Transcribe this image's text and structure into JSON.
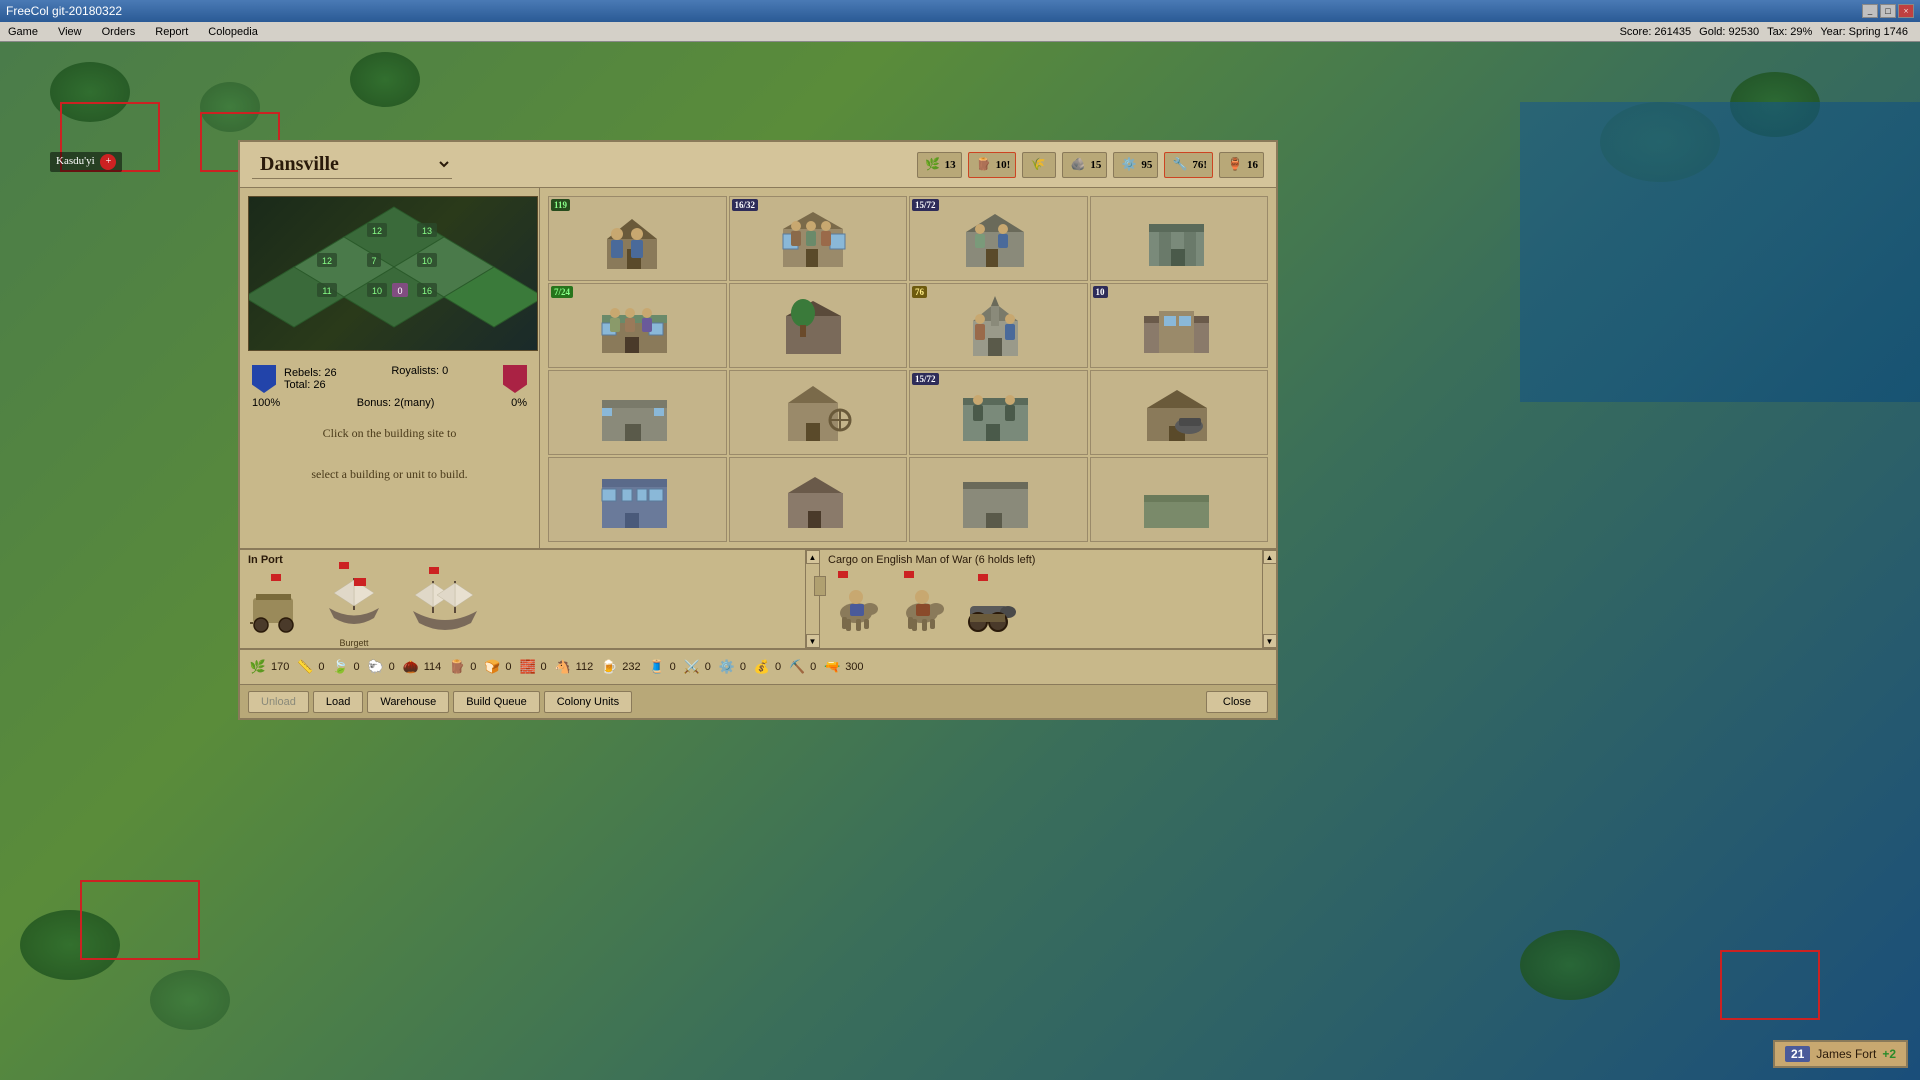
{
  "window": {
    "title": "FreeCol git-20180322",
    "buttons": [
      "_",
      "□",
      "×"
    ]
  },
  "menu": {
    "items": [
      "Game",
      "View",
      "Orders",
      "Report",
      "Colopedia"
    ]
  },
  "statusBar": {
    "score": "Score: 261435",
    "gold": "Gold: 92530",
    "tax": "Tax: 29%",
    "year": "Year: Spring 1746"
  },
  "colonyDialog": {
    "title": "Dansville",
    "resources": [
      {
        "icon": "🌿",
        "value": "13",
        "color": "#4a8a4a"
      },
      {
        "icon": "🪵",
        "value": "10!",
        "color": "#8a5a2a"
      },
      {
        "icon": "🌾",
        "value": "",
        "color": "#8a8a2a"
      },
      {
        "icon": "🪨",
        "value": "15",
        "color": "#7a7a7a"
      },
      {
        "icon": "⚙️",
        "value": "95",
        "color": "#6a6a6a"
      },
      {
        "icon": "🔧",
        "value": "76!",
        "color": "#9a6a2a"
      },
      {
        "icon": "🏺",
        "value": "16",
        "color": "#8a5a3a"
      }
    ],
    "colonistStats": {
      "rebels": {
        "label": "Rebels: 26",
        "percent": "100%"
      },
      "total": {
        "label": "Total: 26"
      },
      "royalists": {
        "label": "Royalists: 0",
        "percent": "0%"
      },
      "bonus": {
        "label": "Bonus: 2(many)"
      }
    },
    "instructions": {
      "line1": "Click on the building site to",
      "line2": "select a building or unit to build."
    },
    "buildings": [
      {
        "id": "b1",
        "badge": "119",
        "badgeColor": "green",
        "figures": 0
      },
      {
        "id": "b2",
        "badge": "16/32",
        "badgeColor": "dark",
        "figures": 3
      },
      {
        "id": "b3",
        "badge": "15/72",
        "badgeColor": "dark",
        "figures": 2
      },
      {
        "id": "b4",
        "badge": "",
        "figures": 0
      },
      {
        "id": "b5",
        "badge": "7/24",
        "badgeColor": "green",
        "figures": 3
      },
      {
        "id": "b6",
        "badge": "",
        "figures": 0
      },
      {
        "id": "b7",
        "badge": "76",
        "badgeColor": "yellow",
        "figures": 2
      },
      {
        "id": "b8",
        "badge": "10",
        "badgeColor": "dark",
        "figures": 0
      },
      {
        "id": "b9",
        "badge": "",
        "figures": 0
      },
      {
        "id": "b10",
        "badge": "",
        "figures": 0
      },
      {
        "id": "b11",
        "badge": "15/72",
        "badgeColor": "dark",
        "figures": 2
      },
      {
        "id": "b12",
        "badge": "",
        "figures": 0
      },
      {
        "id": "b13",
        "badge": "",
        "figures": 0
      },
      {
        "id": "b14",
        "badge": "",
        "figures": 0
      },
      {
        "id": "b15",
        "badge": "",
        "figures": 0
      },
      {
        "id": "b16",
        "badge": "",
        "figures": 0
      }
    ],
    "port": {
      "label": "In Port",
      "ships": [
        {
          "type": "wagon",
          "flagged": true
        },
        {
          "type": "ship-small",
          "flagged": true,
          "name": "Burgett"
        },
        {
          "type": "ship-large",
          "flagged": true
        }
      ]
    },
    "cargo": {
      "label": "Cargo on English Man of War (6 holds left)",
      "units": [
        {
          "type": "cavalry",
          "flagged": true
        },
        {
          "type": "cavalry",
          "flagged": true
        },
        {
          "type": "cannon",
          "flagged": true
        }
      ]
    },
    "resourceBar": [
      {
        "icon": "🌿",
        "value": "170"
      },
      {
        "icon": "📏",
        "value": "0"
      },
      {
        "icon": "🍃",
        "value": "0"
      },
      {
        "icon": "🐑",
        "value": "0"
      },
      {
        "icon": "🌰",
        "value": "114"
      },
      {
        "icon": "🪵",
        "value": "0"
      },
      {
        "icon": "🍞",
        "value": "0"
      },
      {
        "icon": "🧱",
        "value": "0"
      },
      {
        "icon": "🐴",
        "value": "112"
      },
      {
        "icon": "🍺",
        "value": "232"
      },
      {
        "icon": "🧵",
        "value": "0"
      },
      {
        "icon": "⚔️",
        "value": "0"
      },
      {
        "icon": "⚙️",
        "value": "0"
      },
      {
        "icon": "💰",
        "value": "0"
      },
      {
        "icon": "⛏️",
        "value": "0"
      },
      {
        "icon": "🔫",
        "value": "300"
      }
    ],
    "buttons": {
      "unload": "Unload",
      "load": "Load",
      "warehouse": "Warehouse",
      "buildQueue": "Build Queue",
      "colonyUnits": "Colony Units",
      "close": "Close"
    }
  },
  "mapLabels": {
    "kasduyi": "Kasdu'yi",
    "fortNotification": "James Fort",
    "fortValue": "+2",
    "fortNum": "21"
  }
}
